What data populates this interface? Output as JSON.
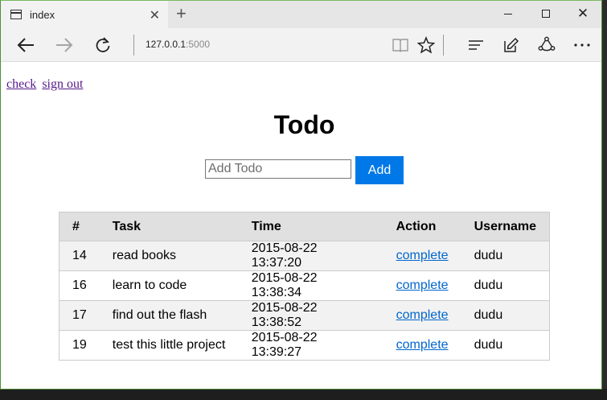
{
  "browser": {
    "tab_title": "index",
    "address_host": "127.0.0.1",
    "address_port": ":5000"
  },
  "links": {
    "check": "check",
    "sign_out": "sign out"
  },
  "page": {
    "title": "Todo",
    "input_placeholder": "Add Todo",
    "add_label": "Add"
  },
  "table": {
    "headers": [
      "#",
      "Task",
      "Time",
      "Action",
      "Username"
    ],
    "rows": [
      {
        "id": "14",
        "task": "read books",
        "time": "2015-08-22 13:37:20",
        "action": "complete",
        "user": "dudu"
      },
      {
        "id": "16",
        "task": "learn to code",
        "time": "2015-08-22 13:38:34",
        "action": "complete",
        "user": "dudu"
      },
      {
        "id": "17",
        "task": "find out the flash",
        "time": "2015-08-22 13:38:52",
        "action": "complete",
        "user": "dudu"
      },
      {
        "id": "19",
        "task": "test this little project",
        "time": "2015-08-22 13:39:27",
        "action": "complete",
        "user": "dudu"
      }
    ]
  },
  "colors": {
    "accent": "#0078e7",
    "visited_link": "#551a8b",
    "header_bg": "#e0e0e0"
  },
  "icons": [
    "page-icon",
    "close-icon",
    "plus-icon",
    "minimize-icon",
    "maximize-icon",
    "back-arrow-icon",
    "forward-arrow-icon",
    "refresh-icon",
    "reading-view-icon",
    "favorite-star-icon",
    "hub-icon",
    "web-note-icon",
    "share-icon",
    "more-icon"
  ]
}
